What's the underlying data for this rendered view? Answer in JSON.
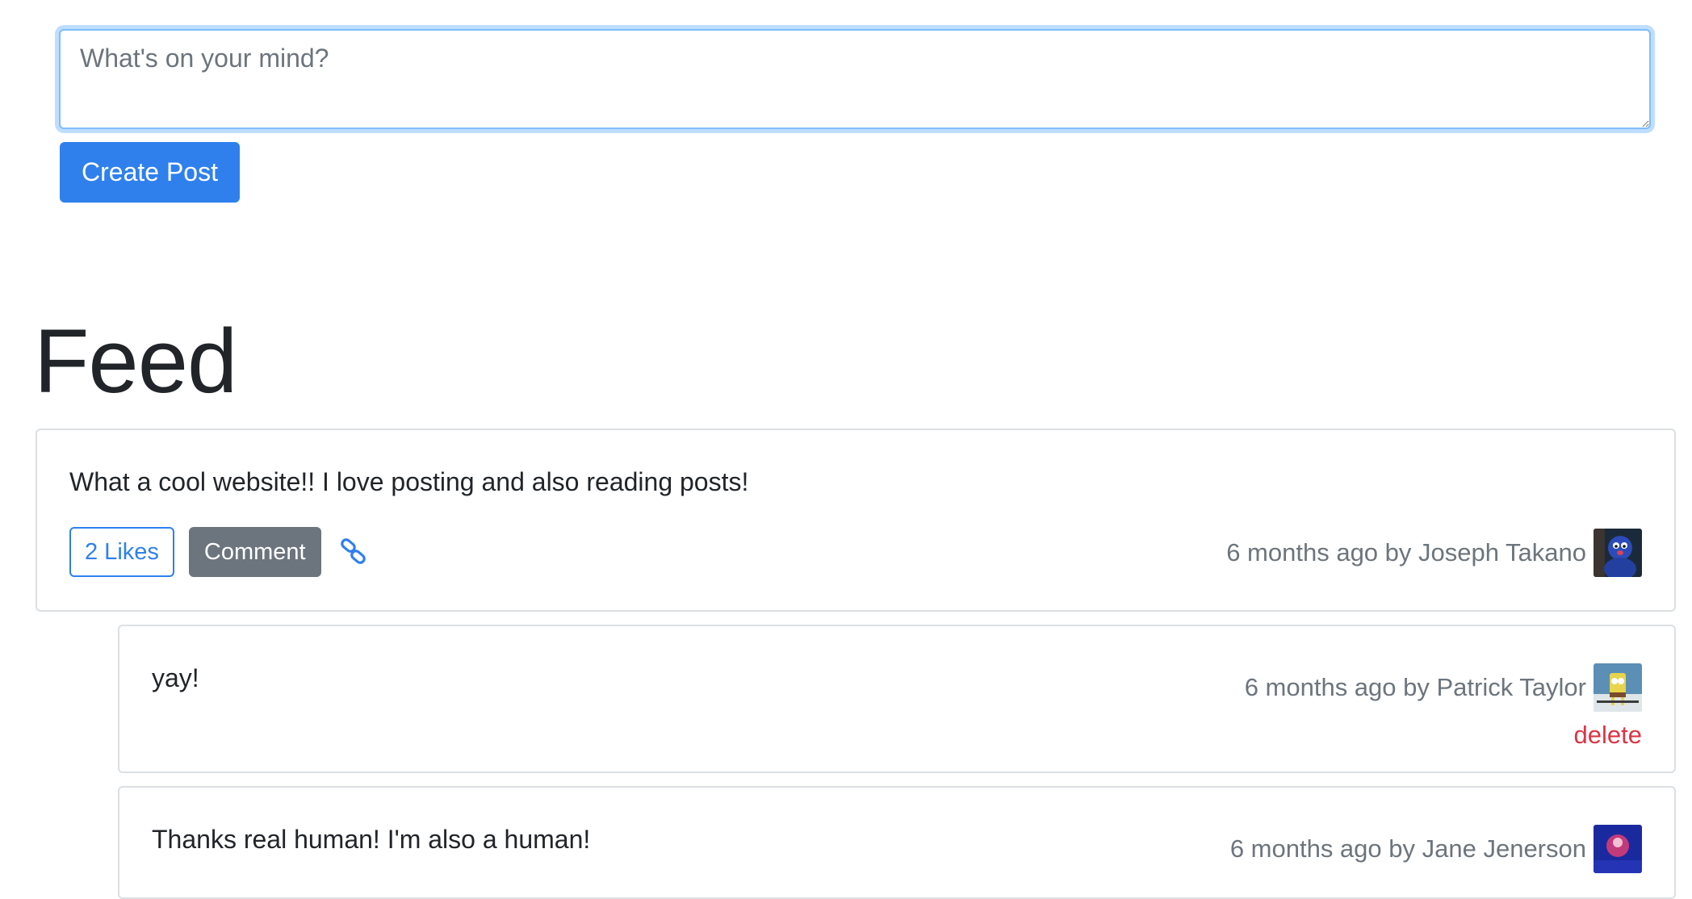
{
  "composer": {
    "placeholder": "What's on your mind?",
    "value": "",
    "submit_label": "Create Post"
  },
  "feed": {
    "title": "Feed"
  },
  "post": {
    "body": "What a cool website!! I love posting and also reading posts!",
    "likes_label": "2 Likes",
    "comment_label": "Comment",
    "link_icon": "link-icon",
    "meta": "6 months ago by Joseph Takano",
    "avatar": "avatar-image"
  },
  "comments": [
    {
      "body": "yay!",
      "meta": "6 months ago by Patrick Taylor",
      "avatar": "avatar-image",
      "delete_label": "delete"
    },
    {
      "body": "Thanks real human! I'm also a human!",
      "meta": "6 months ago by Jane Jenerson",
      "avatar": "avatar-image"
    }
  ],
  "colors": {
    "primary": "#2f80ed",
    "secondary": "#6c757d",
    "danger": "#dc3545",
    "focus_border": "#80bdff"
  }
}
